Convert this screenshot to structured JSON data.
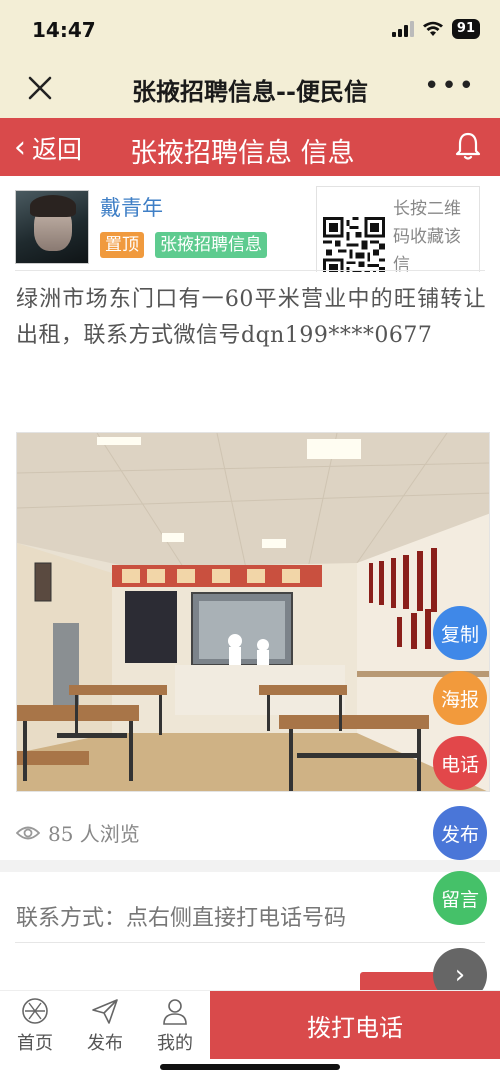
{
  "status_bar": {
    "time": "14:47",
    "battery": "91"
  },
  "browser": {
    "title": "张掖招聘信息--便民信"
  },
  "header": {
    "back_label": "返回",
    "title": "张掖招聘信息 信息"
  },
  "author": {
    "name": "戴青年",
    "tag_pinned": "置顶",
    "tag_category": "张掖招聘信息"
  },
  "qr": {
    "text": "长按二维码收藏该信"
  },
  "post": {
    "content": "绿洲市场东门口有一60平米营业中的旺铺转让出租，联系方式微信号dqn199****0677",
    "views": "85 人浏览",
    "contact": "联系方式：点右侧直接打电话号码"
  },
  "float_buttons": {
    "copy": "复制",
    "poster": "海报",
    "phone": "电话",
    "publish": "发布",
    "message": "留言"
  },
  "bottom_bar": {
    "home": "首页",
    "publish": "发布",
    "mine": "我的",
    "call": "拨打电话"
  },
  "colors": {
    "accent_red": "#d94a4b",
    "browser_bg": "#f3eed6",
    "link_blue": "#3f7fc6"
  }
}
